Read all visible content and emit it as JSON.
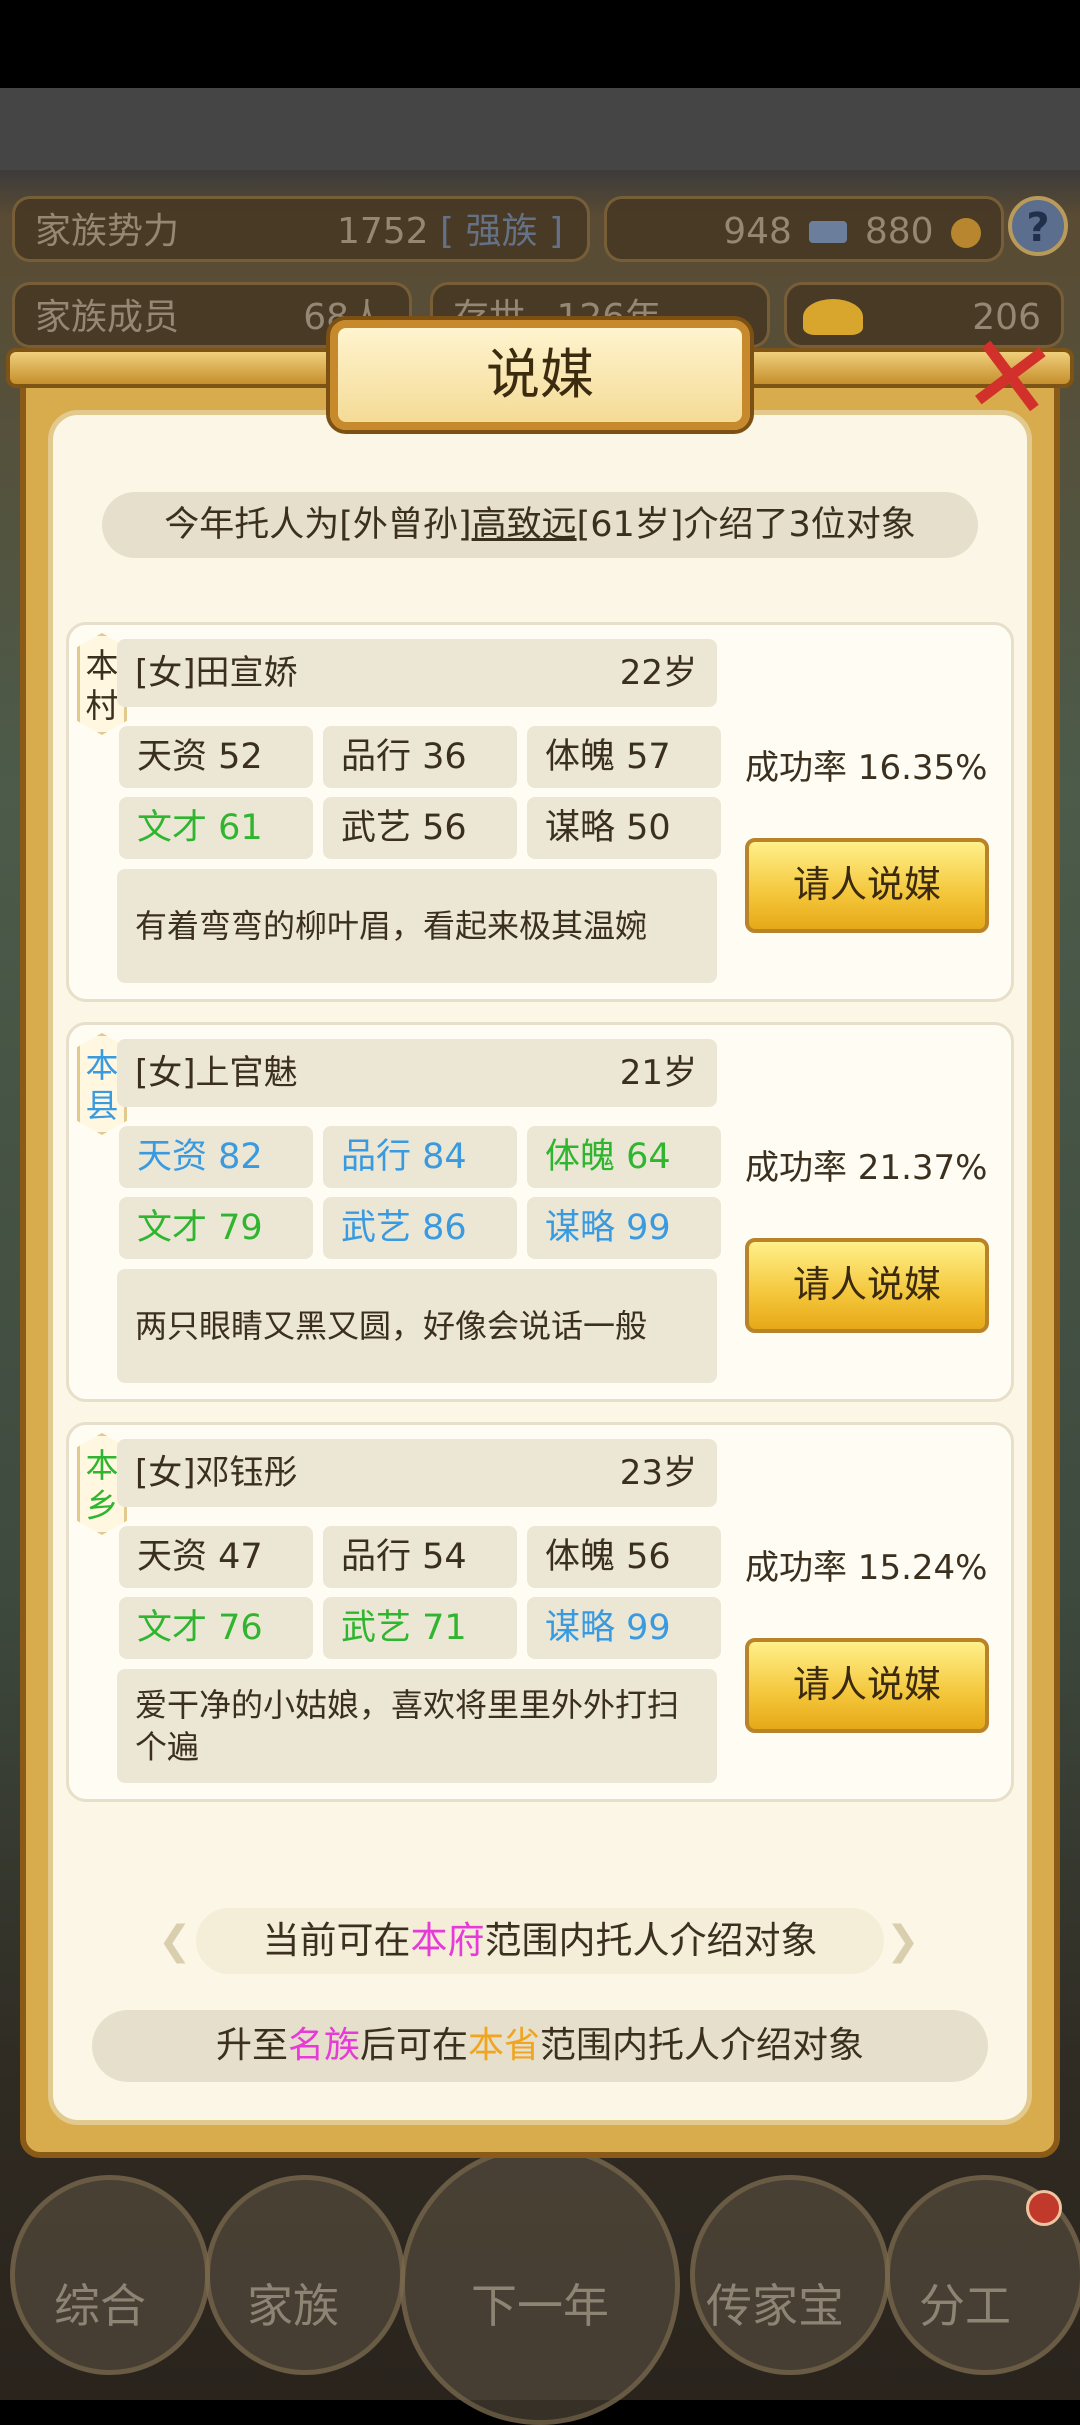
{
  "background": {
    "hud": {
      "family_power_label": "家族势力",
      "family_power_value": "1752",
      "family_power_rank": "[ 强族 ]",
      "currency_a": "948",
      "currency_b": "880",
      "family_members_label": "家族成员",
      "family_members_value": "68人",
      "existence_label": "存世",
      "existence_value": "126年",
      "gold_value": "206",
      "help_symbol": "?"
    },
    "nav": [
      "综合",
      "家族",
      "下一年",
      "传家宝",
      "分工"
    ]
  },
  "dialog": {
    "title": "说媒",
    "close_symbol": "✕",
    "summary": {
      "prefix": "今年托人为[外曾孙]",
      "person": "高致远",
      "suffix": "[61岁]介绍了3位对象"
    },
    "candidates": [
      {
        "tag": "本村",
        "tag_color": "#3b3020",
        "name": "[女]田宣娇",
        "age": "22岁",
        "stats": [
          {
            "label": "天资 52",
            "color": "dark"
          },
          {
            "label": "品行 36",
            "color": "dark"
          },
          {
            "label": "体魄 57",
            "color": "dark"
          },
          {
            "label": "文才 61",
            "color": "green"
          },
          {
            "label": "武艺 56",
            "color": "dark"
          },
          {
            "label": "谋略 50",
            "color": "dark"
          }
        ],
        "description": "有着弯弯的柳叶眉，看起来极其温婉",
        "success_rate": "成功率 16.35%",
        "button": "请人说媒"
      },
      {
        "tag": "本县",
        "tag_color": "#3a9ae0",
        "name": "[女]上官魅",
        "age": "21岁",
        "stats": [
          {
            "label": "天资 82",
            "color": "blue"
          },
          {
            "label": "品行 84",
            "color": "blue"
          },
          {
            "label": "体魄 64",
            "color": "green"
          },
          {
            "label": "文才 79",
            "color": "green"
          },
          {
            "label": "武艺 86",
            "color": "blue"
          },
          {
            "label": "谋略 99",
            "color": "blue"
          }
        ],
        "description": "两只眼睛又黑又圆，好像会说话一般",
        "success_rate": "成功率 21.37%",
        "button": "请人说媒"
      },
      {
        "tag": "本乡",
        "tag_color": "#2fb52f",
        "name": "[女]邓钰彤",
        "age": "23岁",
        "stats": [
          {
            "label": "天资 47",
            "color": "dark"
          },
          {
            "label": "品行 54",
            "color": "dark"
          },
          {
            "label": "体魄 56",
            "color": "dark"
          },
          {
            "label": "文才 76",
            "color": "green"
          },
          {
            "label": "武艺 71",
            "color": "green"
          },
          {
            "label": "谋略 99",
            "color": "blue"
          }
        ],
        "description": "爱干净的小姑娘，喜欢将里里外外打扫个遍",
        "success_rate": "成功率 15.24%",
        "button": "请人说媒"
      }
    ],
    "scope": {
      "prefix": "当前可在",
      "highlight": "本府",
      "suffix": "范围内托人介绍对象"
    },
    "upgrade": {
      "p1": "升至",
      "h1": "名族",
      "p2": "后可在",
      "h2": "本省",
      "p3": "范围内托人介绍对象"
    }
  }
}
